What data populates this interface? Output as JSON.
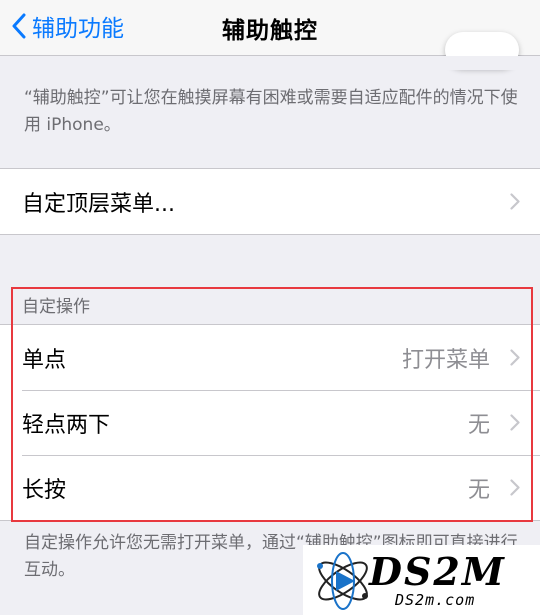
{
  "navbar": {
    "back_label": "辅助功能",
    "title": "辅助触控"
  },
  "top_footnote": "“辅助触控”可让您在触摸屏幕有困难或需要自适应配件的情况下使用 iPhone。",
  "menu_row": {
    "label": "自定顶层菜单..."
  },
  "custom_actions": {
    "header": "自定操作",
    "rows": [
      {
        "label": "单点",
        "value": "打开菜单"
      },
      {
        "label": "轻点两下",
        "value": "无"
      },
      {
        "label": "长按",
        "value": "无"
      }
    ],
    "footnote": "自定操作允许您无需打开菜单，通过“辅助触控”图标即可直接进行互动。"
  },
  "watermark": {
    "text": "DS2M",
    "url": "DS2m.com"
  },
  "colors": {
    "accent": "#0a7aff",
    "highlight_box": "#e8393f",
    "background": "#efeff4"
  },
  "icons": {
    "back": "chevron-left-icon",
    "disclosure": "chevron-right-icon"
  }
}
